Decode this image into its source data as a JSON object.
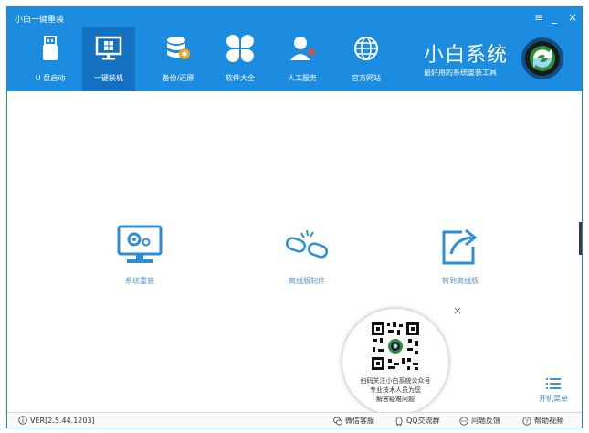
{
  "window": {
    "title": "小白一键重装"
  },
  "window_controls": {
    "menu": "≡",
    "minimize": "_",
    "close": "×"
  },
  "nav": {
    "items": [
      {
        "label": "U 盘启动",
        "icon": "usb-drive-icon"
      },
      {
        "label": "一键装机",
        "icon": "monitor-windows-icon",
        "active": true
      },
      {
        "label": "备份/还原",
        "icon": "database-backup-icon"
      },
      {
        "label": "软件大全",
        "icon": "apps-grid-icon"
      },
      {
        "label": "人工服务",
        "icon": "support-person-icon"
      },
      {
        "label": "官方网站",
        "icon": "globe-icon"
      }
    ]
  },
  "brand": {
    "name": "小白系统",
    "tagline": "最好用的系统重装工具"
  },
  "actions": [
    {
      "label": "系统重装",
      "icon": "monitor-gear-icon"
    },
    {
      "label": "离线版制作",
      "icon": "broken-link-icon"
    },
    {
      "label": "转到离线版",
      "icon": "share-arrow-icon"
    }
  ],
  "qr_popup": {
    "line1": "扫码关注小白系统公众号",
    "line2": "专业技术人员为您",
    "line3": "解答疑难问题",
    "close": "×"
  },
  "boot_menu": {
    "label": "开机菜单"
  },
  "footer": {
    "version": "VER[2.5.44.1203]",
    "wechat": "微信客服",
    "qq": "QQ交流群",
    "feedback": "问题反馈",
    "help": "帮助视频"
  },
  "colors": {
    "header": "#1c8ce0",
    "active_tab": "#1470c0",
    "accent": "#4a90d0"
  }
}
